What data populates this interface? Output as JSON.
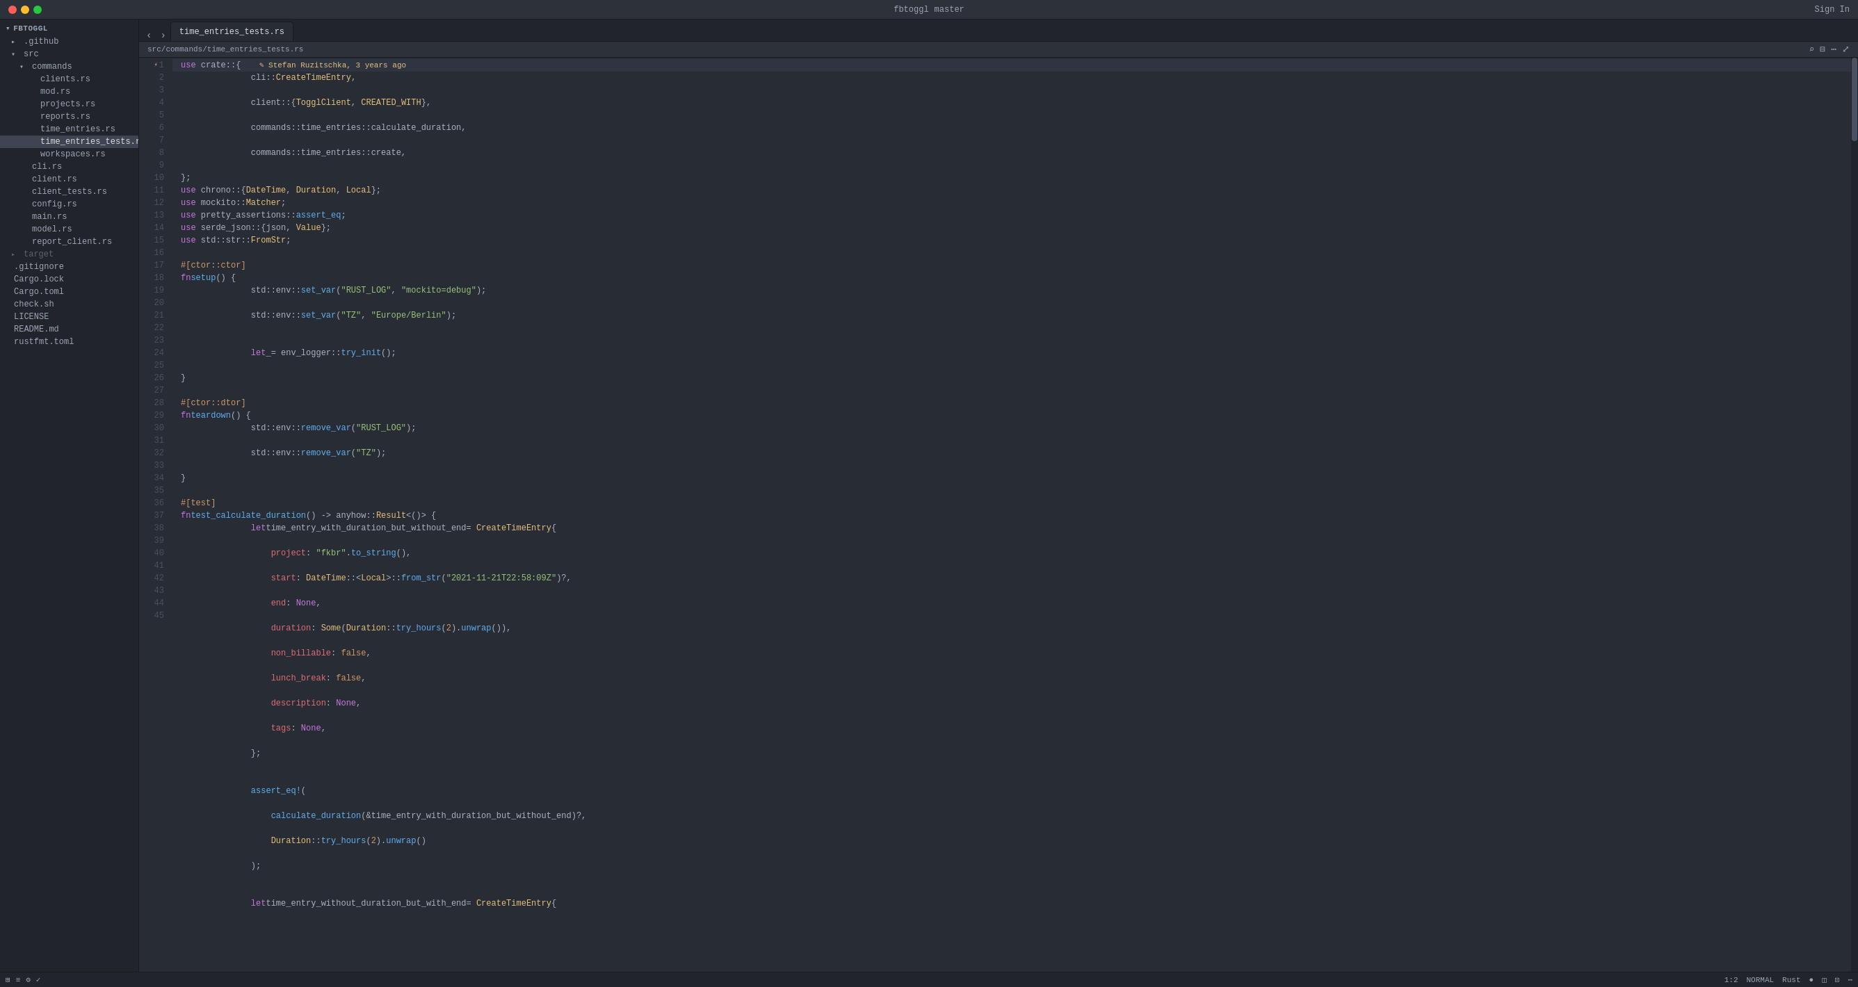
{
  "titlebar": {
    "repo": "fbtoggl",
    "branch": "master",
    "sign_in": "Sign In"
  },
  "tabs": [
    {
      "label": "time_entries_tests.rs",
      "active": true
    }
  ],
  "breadcrumb": "src/commands/time_entries_tests.rs",
  "sidebar": {
    "repo": "fbtoggl",
    "items": [
      {
        "label": ".github",
        "type": "folder",
        "indent": 1
      },
      {
        "label": "src",
        "type": "folder",
        "indent": 1,
        "open": true
      },
      {
        "label": "commands",
        "type": "folder",
        "indent": 2,
        "open": true
      },
      {
        "label": "clients.rs",
        "type": "file",
        "indent": 3
      },
      {
        "label": "mod.rs",
        "type": "file",
        "indent": 3
      },
      {
        "label": "projects.rs",
        "type": "file",
        "indent": 3
      },
      {
        "label": "reports.rs",
        "type": "file",
        "indent": 3
      },
      {
        "label": "time_entries.rs",
        "type": "file",
        "indent": 3
      },
      {
        "label": "time_entries_tests.rs",
        "type": "file",
        "indent": 3,
        "active": true
      },
      {
        "label": "workspaces.rs",
        "type": "file",
        "indent": 3
      },
      {
        "label": "cli.rs",
        "type": "file",
        "indent": 2
      },
      {
        "label": "client.rs",
        "type": "file",
        "indent": 2
      },
      {
        "label": "client_tests.rs",
        "type": "file",
        "indent": 2
      },
      {
        "label": "config.rs",
        "type": "file",
        "indent": 2
      },
      {
        "label": "main.rs",
        "type": "file",
        "indent": 2
      },
      {
        "label": "model.rs",
        "type": "file",
        "indent": 2
      },
      {
        "label": "report_client.rs",
        "type": "file",
        "indent": 2
      },
      {
        "label": "target",
        "type": "folder",
        "indent": 1,
        "closed": true
      },
      {
        "label": ".gitignore",
        "type": "file",
        "indent": 1
      },
      {
        "label": "Cargo.lock",
        "type": "file",
        "indent": 1
      },
      {
        "label": "Cargo.toml",
        "type": "file",
        "indent": 1
      },
      {
        "label": "check.sh",
        "type": "file",
        "indent": 1
      },
      {
        "label": "LICENSE",
        "type": "file",
        "indent": 1
      },
      {
        "label": "README.md",
        "type": "file",
        "indent": 1
      },
      {
        "label": "rustfmt.toml",
        "type": "file",
        "indent": 1
      }
    ]
  },
  "blame": {
    "author": "Stefan Ruzitschka",
    "time": "3 years ago"
  },
  "status": {
    "position": "1:2",
    "mode": "NORMAL",
    "language": "Rust"
  },
  "code_lines": [
    {
      "num": 1,
      "content": "use crate::{",
      "blame": true
    },
    {
      "num": 2,
      "content": "    cli::CreateTimeEntry,"
    },
    {
      "num": 3,
      "content": "    client::{TogglClient, CREATED_WITH},"
    },
    {
      "num": 4,
      "content": "    commands::time_entries::calculate_duration,"
    },
    {
      "num": 5,
      "content": "    commands::time_entries::create,"
    },
    {
      "num": 6,
      "content": "};"
    },
    {
      "num": 7,
      "content": "use chrono::{DateTime, Duration, Local};"
    },
    {
      "num": 8,
      "content": "use mockito::Matcher;"
    },
    {
      "num": 9,
      "content": "use pretty_assertions::assert_eq;"
    },
    {
      "num": 10,
      "content": "use serde_json::{json, Value};"
    },
    {
      "num": 11,
      "content": "use std::str::FromStr;"
    },
    {
      "num": 12,
      "content": ""
    },
    {
      "num": 13,
      "content": "#[ctor::ctor]"
    },
    {
      "num": 14,
      "content": "fn setup() {"
    },
    {
      "num": 15,
      "content": "    std::env::set_var(\"RUST_LOG\", \"mockito=debug\");"
    },
    {
      "num": 16,
      "content": "    std::env::set_var(\"TZ\", \"Europe/Berlin\");"
    },
    {
      "num": 17,
      "content": ""
    },
    {
      "num": 18,
      "content": "    let _ = env_logger::try_init();"
    },
    {
      "num": 19,
      "content": "}"
    },
    {
      "num": 20,
      "content": ""
    },
    {
      "num": 21,
      "content": "#[ctor::dtor]"
    },
    {
      "num": 22,
      "content": "fn teardown() {"
    },
    {
      "num": 23,
      "content": "    std::env::remove_var(\"RUST_LOG\");"
    },
    {
      "num": 24,
      "content": "    std::env::remove_var(\"TZ\");"
    },
    {
      "num": 25,
      "content": "}"
    },
    {
      "num": 26,
      "content": ""
    },
    {
      "num": 27,
      "content": "#[test]"
    },
    {
      "num": 28,
      "content": "fn test_calculate_duration() -> anyhow::Result<()> {",
      "collapse": true
    },
    {
      "num": 29,
      "content": "    let time_entry_with_duration_but_without_end = CreateTimeEntry {"
    },
    {
      "num": 30,
      "content": "        project: \"fkbr\".to_string(),"
    },
    {
      "num": 31,
      "content": "        start: DateTime::<Local>::from_str(\"2021-11-21T22:58:09Z\"),"
    },
    {
      "num": 32,
      "content": "        end: None,"
    },
    {
      "num": 33,
      "content": "        duration: Some(Duration::try_hours(2).unwrap()),"
    },
    {
      "num": 34,
      "content": "        non_billable: false,"
    },
    {
      "num": 35,
      "content": "        lunch_break: false,"
    },
    {
      "num": 36,
      "content": "        description: None,"
    },
    {
      "num": 37,
      "content": "        tags: None,"
    },
    {
      "num": 38,
      "content": "    };"
    },
    {
      "num": 39,
      "content": ""
    },
    {
      "num": 40,
      "content": "    assert_eq!("
    },
    {
      "num": 41,
      "content": "        calculate_duration(&time_entry_with_duration_but_without_end)?,"
    },
    {
      "num": 42,
      "content": "        Duration::try_hours(2).unwrap()"
    },
    {
      "num": 43,
      "content": "    );"
    },
    {
      "num": 44,
      "content": ""
    },
    {
      "num": 45,
      "content": "    let time_entry_without_duration_but_with_end = CreateTimeEntry {"
    }
  ]
}
